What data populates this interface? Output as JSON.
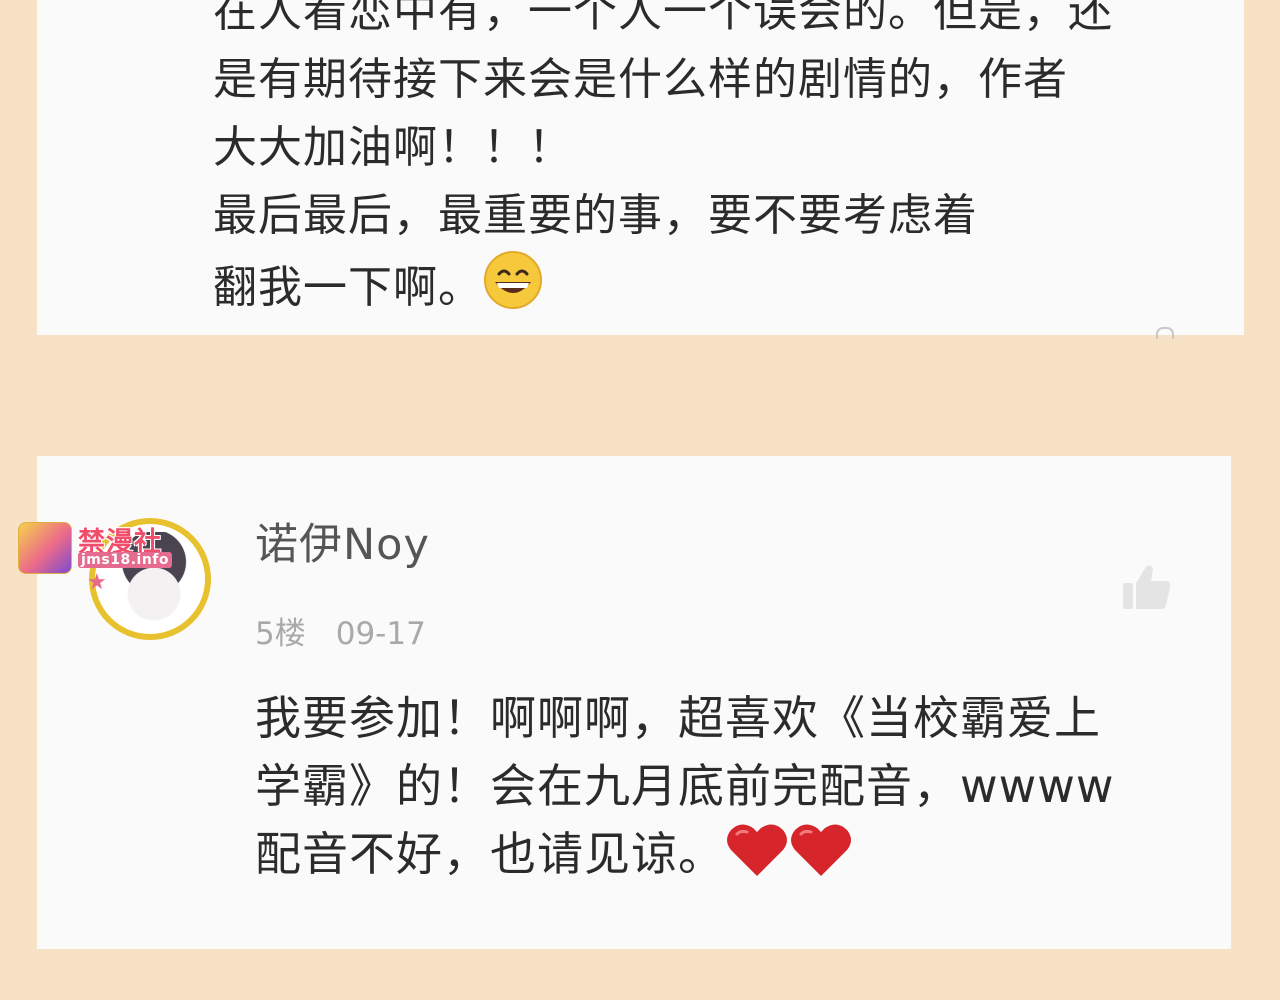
{
  "comments": [
    {
      "lines": [
        "在人看恋中有，一个人一个误会的。但是，还",
        "是有期待接下来会是什么样的剧情的，作者",
        "大大加油啊！！！",
        "最后最后，最重要的事，要不要考虑着",
        "翻我一下啊。"
      ],
      "emoji": "grinning-face-emoji"
    },
    {
      "username": "诺伊Noy",
      "floor": "5楼",
      "date": "09-17",
      "lines": [
        "我要参加！啊啊啊，超喜欢《当校霸爱上",
        "学霸》的！会在九月底前完配音，wwww",
        "配音不好，也请见谅。"
      ],
      "emoji": "red-heart-emoji x2"
    }
  ],
  "watermark": {
    "title": "禁漫社",
    "url": "jms18.info"
  },
  "colors": {
    "background": "#f8e2c5",
    "card": "#fbfafa",
    "avatar_ring": "#e8c12e",
    "heart": "#d7262b"
  }
}
